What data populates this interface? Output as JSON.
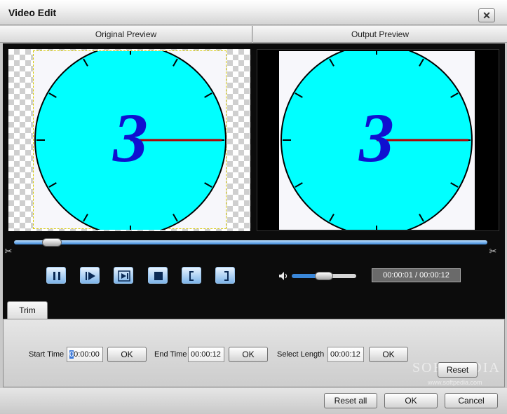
{
  "window": {
    "title": "Video Edit",
    "close_glyph": "✕"
  },
  "preview": {
    "original_label": "Original Preview",
    "output_label": "Output Preview",
    "countdown_number": "3"
  },
  "playback": {
    "position_fraction": 0.08,
    "volume_fraction": 0.45,
    "time_display": "00:00:01 / 00:00:12",
    "buttons": [
      "pause-icon",
      "step-forward-icon",
      "next-frame-icon",
      "stop-icon",
      "mark-in-icon",
      "mark-out-icon"
    ]
  },
  "tabs": [
    {
      "label": "Trim"
    }
  ],
  "trim": {
    "start_label": "Start Time",
    "start_value_first": "0",
    "start_value_rest": "0:00:00",
    "end_label": "End Time",
    "end_value": "00:00:12",
    "length_label": "Select Length",
    "length_value": "00:00:12",
    "ok_label": "OK",
    "reset_label": "Reset"
  },
  "watermark": {
    "text": "SOFTPEDIA",
    "url": "www.softpedia.com"
  },
  "footer": {
    "reset_all_label": "Reset all",
    "ok_label": "OK",
    "cancel_label": "Cancel"
  },
  "colors": {
    "clock_face": "#00ffff",
    "digit": "#1010d0",
    "hand": "#b00000",
    "accent_blue": "#3a87d9"
  }
}
